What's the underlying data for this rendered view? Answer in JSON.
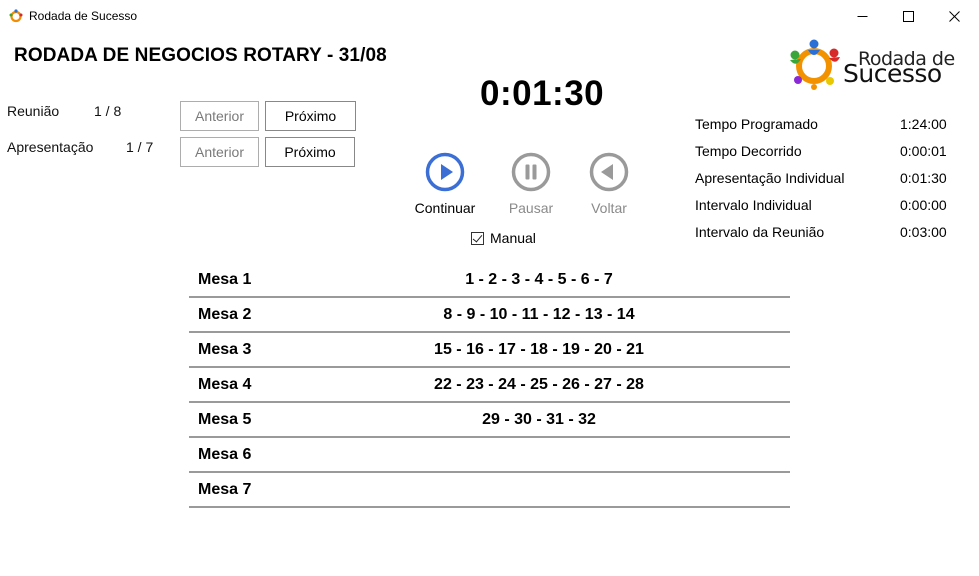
{
  "window": {
    "title": "Rodada de Sucesso",
    "icon": "app-logo-icon",
    "controls": [
      "minimize-icon",
      "maximize-icon",
      "close-icon"
    ]
  },
  "header": {
    "title": "RODADA DE NEGOCIOS ROTARY - 31/08"
  },
  "logo": {
    "line1": "Rodada de",
    "line2": "Sucesso"
  },
  "meeting": {
    "label": "Reunião",
    "count": "1 / 8",
    "prev_label": "Anterior",
    "next_label": "Próximo"
  },
  "presentation": {
    "label": "Apresentação",
    "count": "1 / 7",
    "prev_label": "Anterior",
    "next_label": "Próximo"
  },
  "timer": {
    "value": "0:01:30"
  },
  "controls": {
    "continue_label": "Continuar",
    "pause_label": "Pausar",
    "back_label": "Voltar",
    "accent_color": "#3b6fd6",
    "disabled_color": "#9a9a9a"
  },
  "manual": {
    "label": "Manual",
    "checked": true
  },
  "stats": [
    {
      "label": "Tempo Programado",
      "value": "1:24:00"
    },
    {
      "label": "Tempo Decorrido",
      "value": "0:00:01"
    },
    {
      "label": "Apresentação Individual",
      "value": "0:01:30"
    },
    {
      "label": "Intervalo Individual",
      "value": "0:00:00"
    },
    {
      "label": "Intervalo da Reunião",
      "value": "0:03:00"
    }
  ],
  "mesas": [
    {
      "name": "Mesa 1",
      "members": "1 - 2 - 3 - 4 - 5 - 6 - 7"
    },
    {
      "name": "Mesa 2",
      "members": "8 - 9 - 10 - 11 - 12 - 13 - 14"
    },
    {
      "name": "Mesa 3",
      "members": "15 - 16 - 17 - 18 - 19 - 20 - 21"
    },
    {
      "name": "Mesa 4",
      "members": "22 - 23 - 24 - 25 - 26 - 27 - 28"
    },
    {
      "name": "Mesa 5",
      "members": "29 - 30 - 31 - 32"
    },
    {
      "name": "Mesa 6",
      "members": ""
    },
    {
      "name": "Mesa 7",
      "members": ""
    }
  ]
}
